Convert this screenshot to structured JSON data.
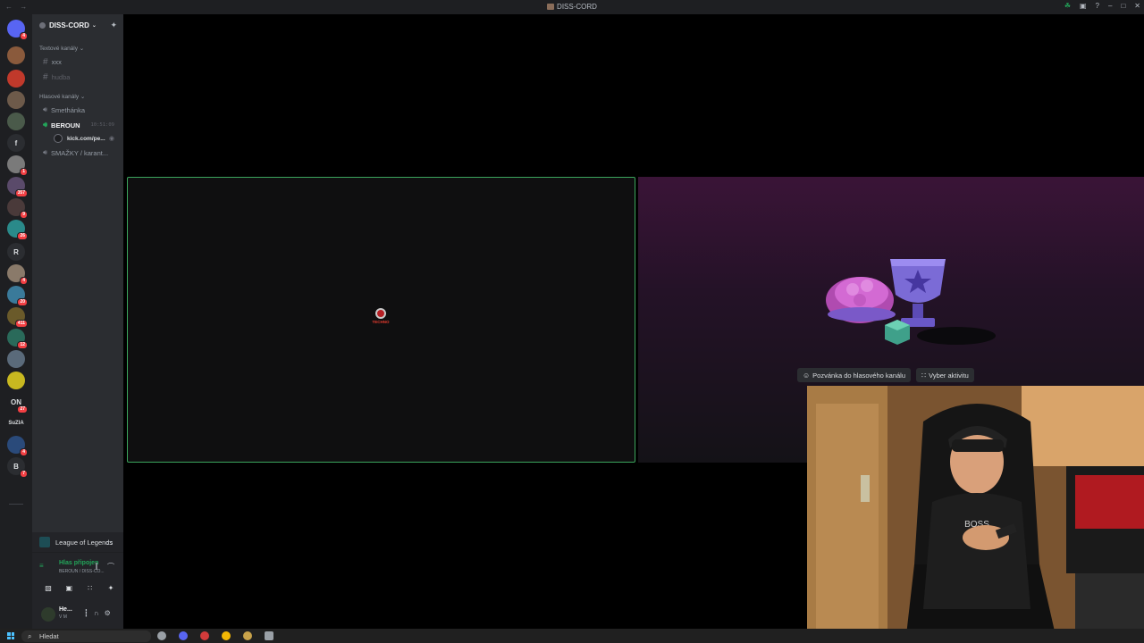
{
  "titlebar": {
    "nav": "← →",
    "title": "DISS-CORD",
    "controls": [
      "–",
      "□",
      "✕"
    ]
  },
  "guilds": [
    {
      "label": "",
      "color": "#5865f2",
      "badge": "4"
    },
    {
      "label": "",
      "color": "#8a5a3c",
      "badge": ""
    },
    {
      "label": "",
      "color": "#c0392b",
      "badge": ""
    },
    {
      "label": "",
      "color": "#6d5a4a",
      "badge": ""
    },
    {
      "label": "",
      "color": "#4a5a4a",
      "badge": ""
    },
    {
      "label": "f",
      "color": "#2b2d31",
      "badge": ""
    },
    {
      "label": "",
      "color": "#7a7a7a",
      "badge": "1"
    },
    {
      "label": "",
      "color": "#5a4a6a",
      "badge": "357"
    },
    {
      "label": "",
      "color": "#4a3a3a",
      "badge": "9"
    },
    {
      "label": "",
      "color": "#2a8a8a",
      "badge": "26"
    },
    {
      "label": "R",
      "color": "#2b2d31",
      "badge": ""
    },
    {
      "label": "",
      "color": "#8a7a6a",
      "badge": "4"
    },
    {
      "label": "",
      "color": "#3a7a9a",
      "badge": "20"
    },
    {
      "label": "",
      "color": "#6a5a2a",
      "badge": "411"
    },
    {
      "label": "",
      "color": "#2a6a5a",
      "badge": "12"
    },
    {
      "label": "",
      "color": "#5a6a7a",
      "badge": ""
    },
    {
      "label": "",
      "color": "#c8b820",
      "badge": ""
    },
    {
      "label": "ON",
      "color": "#1e1f22",
      "badge": "27"
    },
    {
      "label": "SuZIA",
      "color": "#2b2d31",
      "badge": ""
    },
    {
      "label": "",
      "color": "#2a4a7a",
      "badge": "4"
    },
    {
      "label": "B",
      "color": "#2b2d31",
      "badge": "7"
    }
  ],
  "server": {
    "name": "DISS-CORD",
    "text_category": "Textové kanály",
    "text_channels": [
      {
        "name": "xxx",
        "muted": false
      },
      {
        "name": "hudba",
        "muted": true
      }
    ],
    "voice_category": "Hlasové kanály",
    "voice_channels": [
      {
        "name": "Smethánka"
      },
      {
        "name": "BEROUN",
        "time": "10:51:09"
      },
      {
        "name": "SMAŽKY / karant..."
      }
    ],
    "member": "kick.com/pe..."
  },
  "activity": {
    "name": "League of Legends"
  },
  "voice_status": {
    "connected": "Hlas připojen",
    "channel": "BEROUN / DISS-CO..."
  },
  "user": {
    "name": "He...",
    "status": "V M"
  },
  "stage": {
    "logo_text": "TECHNO",
    "invite_button": "Pozvánka do hlasového kanálu",
    "activity_button": "Vyber aktivitu"
  },
  "taskbar": {
    "search_placeholder": "Hledat"
  },
  "colors": {
    "accent": "#5865f2",
    "online": "#23a55a",
    "speaking": "#3ba55c"
  }
}
